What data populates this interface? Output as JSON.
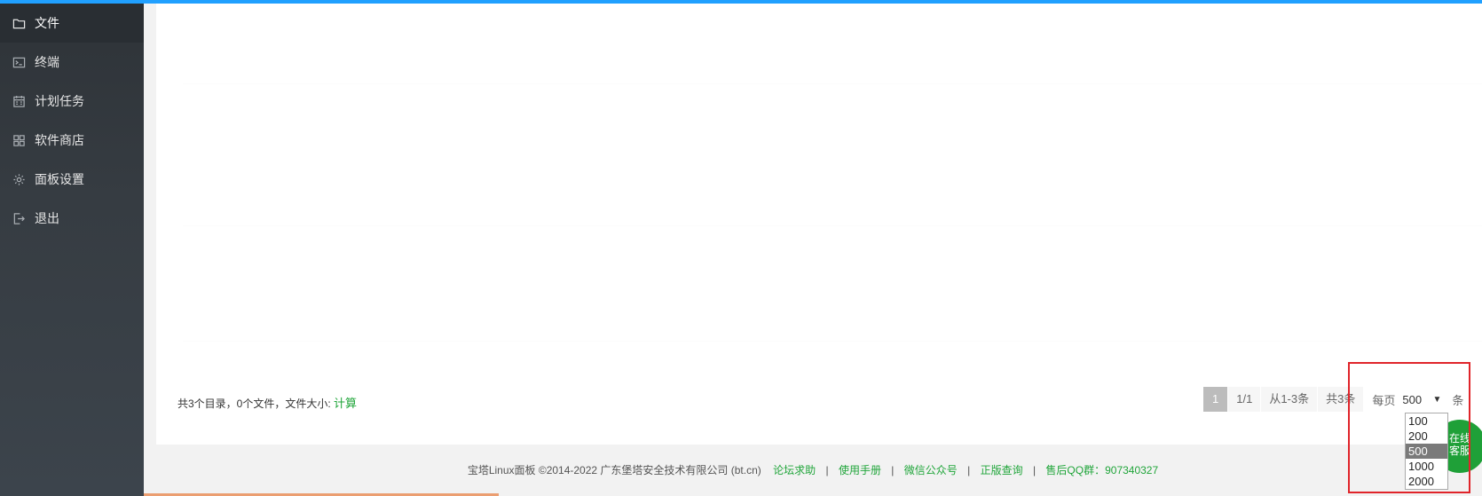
{
  "sidebar": {
    "items": [
      {
        "label": "文件",
        "icon": "folder-icon",
        "active": true
      },
      {
        "label": "终端",
        "icon": "terminal-icon"
      },
      {
        "label": "计划任务",
        "icon": "calendar-icon"
      },
      {
        "label": "软件商店",
        "icon": "grid-icon"
      },
      {
        "label": "面板设置",
        "icon": "gear-icon"
      },
      {
        "label": "退出",
        "icon": "logout-icon"
      }
    ]
  },
  "summary": {
    "text": "共3个目录，0个文件，文件大小:",
    "calc_label": "计算"
  },
  "pager": {
    "current_page": "1",
    "page_info": "1/1",
    "range": "从1-3条",
    "total": "共3条",
    "per_page_label": "每页",
    "per_page_value": "500",
    "unit": "条",
    "options": [
      "100",
      "200",
      "500",
      "1000",
      "2000"
    ],
    "selected_option": "500"
  },
  "kefu": {
    "line1": "在线",
    "line2": "客服"
  },
  "footer": {
    "copyright": "宝塔Linux面板 ©2014-2022 广东堡塔安全技术有限公司 (bt.cn)",
    "links": [
      "论坛求助",
      "使用手册",
      "微信公众号",
      "正版查询"
    ],
    "qq_label": "售后QQ群：907340327"
  },
  "colors": {
    "accent_green": "#20a53a",
    "sidebar_bg": "#363c42",
    "highlight_red": "#e0242a"
  }
}
